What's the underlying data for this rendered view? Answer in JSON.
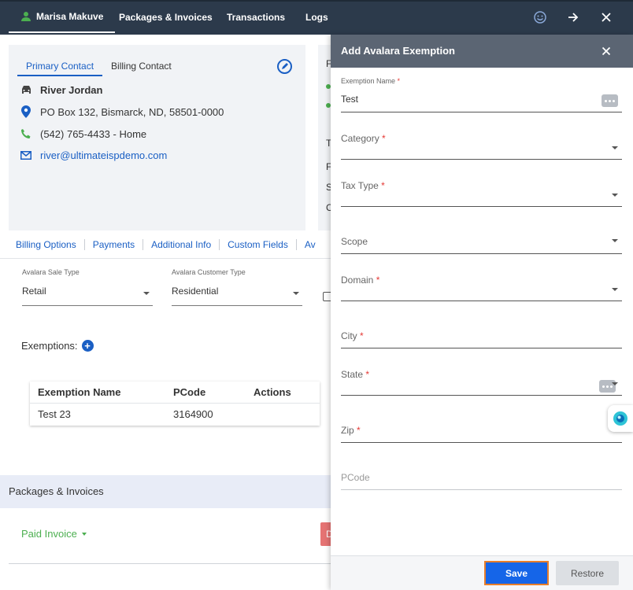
{
  "topnav": {
    "tabs": [
      {
        "label": "Marisa Makuve",
        "active": true
      },
      {
        "label": "Packages & Invoices"
      },
      {
        "label": "Transactions"
      },
      {
        "label": "Logs"
      }
    ],
    "icons": [
      "smile-icon",
      "arrow-right-icon",
      "close-icon"
    ]
  },
  "contact": {
    "tabs": [
      "Primary Contact",
      "Billing Contact"
    ],
    "name": "River Jordan",
    "address": "PO Box 132, Bismarck, ND, 58501-0000",
    "phone": "(542) 765-4433 - Home",
    "email": "river@ultimateispdemo.com"
  },
  "sliver": {
    "t1": "F",
    "t2": "T",
    "t3": "F",
    "t4": "S",
    "t5": "C"
  },
  "subtabs": [
    "Billing Options",
    "Payments",
    "Additional Info",
    "Custom Fields",
    "Av"
  ],
  "avalara": {
    "sale_type_label": "Avalara Sale Type",
    "sale_type_value": "Retail",
    "customer_type_label": "Avalara Customer Type",
    "customer_type_value": "Residential"
  },
  "exemptions": {
    "label": "Exemptions:",
    "columns": [
      "Exemption Name",
      "PCode",
      "Actions"
    ],
    "rows": [
      {
        "name": "Test 23",
        "pcode": "3164900",
        "actions": ""
      }
    ]
  },
  "packages": {
    "header": "Packages & Invoices",
    "filter": "Paid Invoice",
    "red_button_text": "D"
  },
  "panel": {
    "title": "Add Avalara Exemption",
    "fields": {
      "exemption_name": {
        "label": "Exemption Name",
        "value": "Test"
      },
      "category": {
        "label": "Category"
      },
      "tax_type": {
        "label": "Tax Type"
      },
      "scope": {
        "label": "Scope"
      },
      "domain": {
        "label": "Domain"
      },
      "city": {
        "label": "City"
      },
      "state": {
        "label": "State"
      },
      "zip": {
        "label": "Zip"
      },
      "pcode": {
        "label": "PCode"
      }
    },
    "required_marker": "*",
    "save_label": "Save",
    "restore_label": "Restore"
  },
  "colors": {
    "nav_bg": "#2c3a4b",
    "panel_header": "#5b6573",
    "primary": "#1565e8",
    "link": "#1a5fc4",
    "required": "#e53935",
    "success": "#4caf50"
  }
}
